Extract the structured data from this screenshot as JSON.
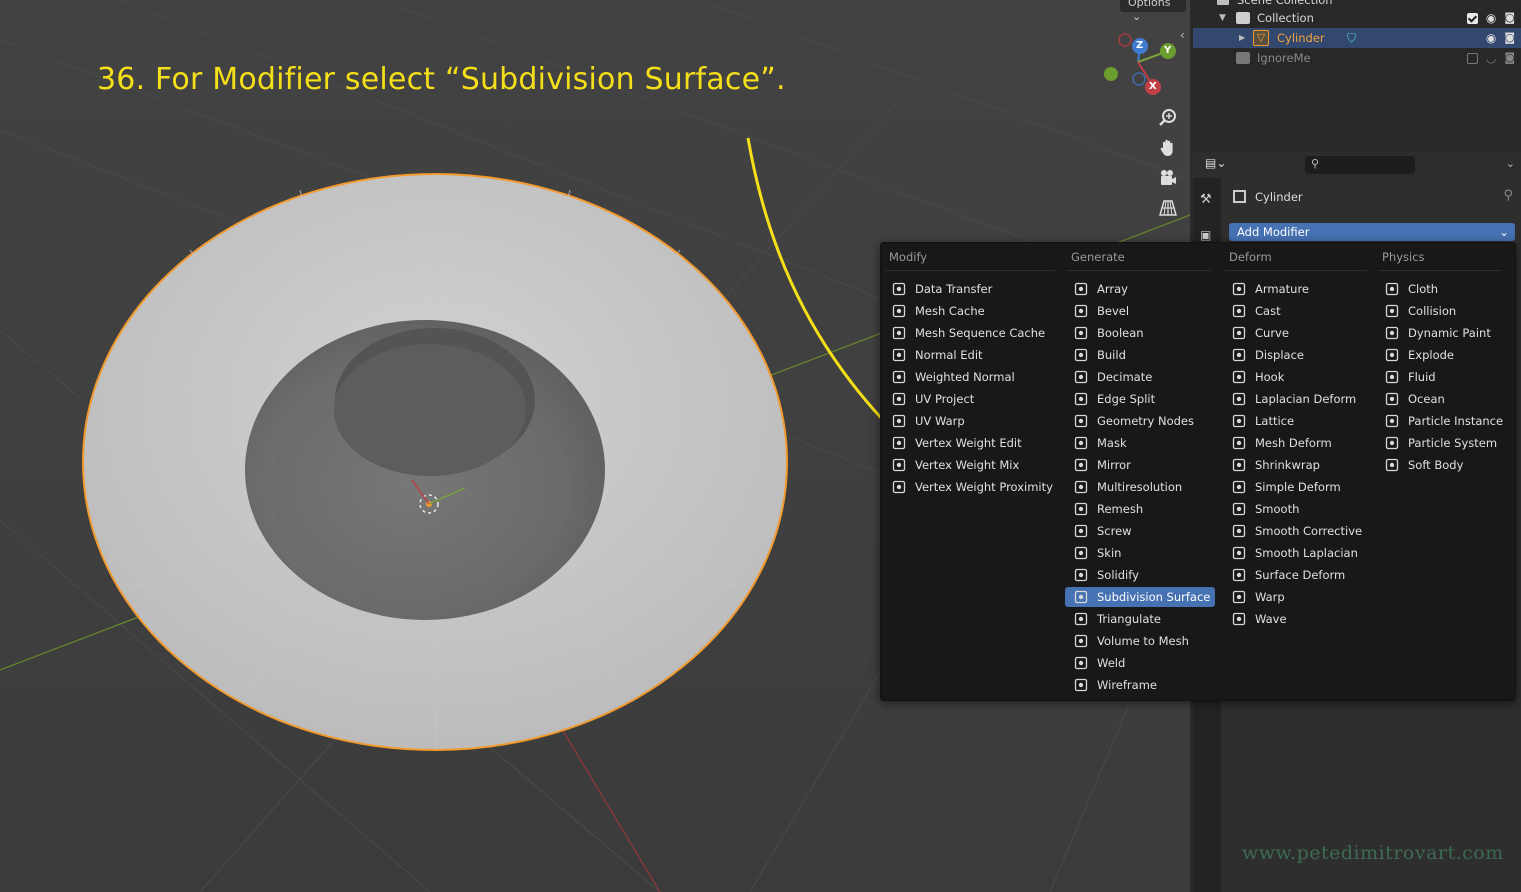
{
  "viewport": {
    "options_label": "Options",
    "caption": "36. For Modifier select “Subdivision Surface”.",
    "gizmo": {
      "z_label": "Z",
      "y_label": "Y",
      "x_label": "X"
    },
    "nav_icons": [
      "zoom-icon",
      "hand-pan-icon",
      "camera-icon",
      "grid-perspective-icon"
    ]
  },
  "outliner": {
    "scene_label": "Scene Collection",
    "rows": [
      {
        "label": "Collection",
        "type": "collection"
      },
      {
        "label": "Cylinder",
        "type": "object",
        "selected": true
      },
      {
        "label": "IgnoreMe",
        "type": "collection-excluded"
      }
    ]
  },
  "properties": {
    "object_name": "Cylinder",
    "add_modifier_label": "Add Modifier"
  },
  "menu": {
    "columns": [
      {
        "heading": "Modify",
        "items": [
          "Data Transfer",
          "Mesh Cache",
          "Mesh Sequence Cache",
          "Normal Edit",
          "Weighted Normal",
          "UV Project",
          "UV Warp",
          "Vertex Weight Edit",
          "Vertex Weight Mix",
          "Vertex Weight Proximity"
        ]
      },
      {
        "heading": "Generate",
        "items": [
          "Array",
          "Bevel",
          "Boolean",
          "Build",
          "Decimate",
          "Edge Split",
          "Geometry Nodes",
          "Mask",
          "Mirror",
          "Multiresolution",
          "Remesh",
          "Screw",
          "Skin",
          "Solidify",
          "Subdivision Surface",
          "Triangulate",
          "Volume to Mesh",
          "Weld",
          "Wireframe"
        ]
      },
      {
        "heading": "Deform",
        "items": [
          "Armature",
          "Cast",
          "Curve",
          "Displace",
          "Hook",
          "Laplacian Deform",
          "Lattice",
          "Mesh Deform",
          "Shrinkwrap",
          "Simple Deform",
          "Smooth",
          "Smooth Corrective",
          "Smooth Laplacian",
          "Surface Deform",
          "Warp",
          "Wave"
        ]
      },
      {
        "heading": "Physics",
        "items": [
          "Cloth",
          "Collision",
          "Dynamic Paint",
          "Explode",
          "Fluid",
          "Ocean",
          "Particle Instance",
          "Particle System",
          "Soft Body"
        ]
      }
    ],
    "highlighted": "Subdivision Surface"
  },
  "watermark": "www.petedimitrovart.com",
  "colors": {
    "accent": "#4671b3",
    "caption": "#f5df19",
    "selection_outline": "#f29a2e"
  }
}
